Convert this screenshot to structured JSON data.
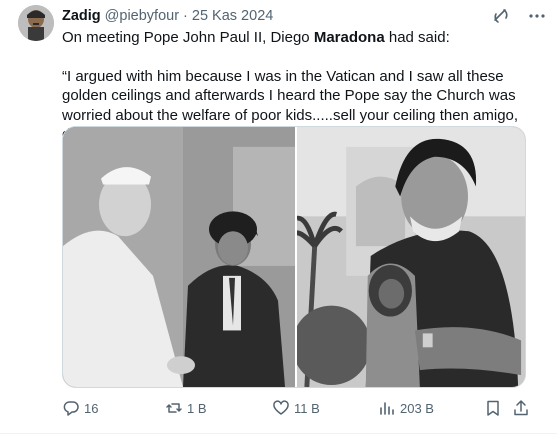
{
  "tweet": {
    "author": {
      "name": "Zadig",
      "handle": "@piebyfour",
      "date": "25 Kas 2024"
    },
    "body": {
      "line_prefix": "On meeting Pope John Paul II, Diego ",
      "line_bold": "Maradona",
      "line_suffix": " had said:",
      "quote": "“I argued with him because I was in the Vatican and I saw all these golden ceilings and afterwards I heard the Pope say the Church was worried about the welfare of poor kids.....sell your ceiling then amigo, do something!”"
    },
    "stats": {
      "replies": "16",
      "reposts": "1 B",
      "likes": "11 B",
      "views": "203 B"
    }
  },
  "icons": {
    "grok": "grok-icon",
    "more": "more-icon",
    "reply": "reply-icon",
    "repost": "repost-icon",
    "like": "heart-icon",
    "views": "views-icon",
    "bookmark": "bookmark-icon",
    "share": "share-icon"
  },
  "colors": {
    "text": "#0f1419",
    "muted": "#536471",
    "border": "#cfd9de"
  }
}
